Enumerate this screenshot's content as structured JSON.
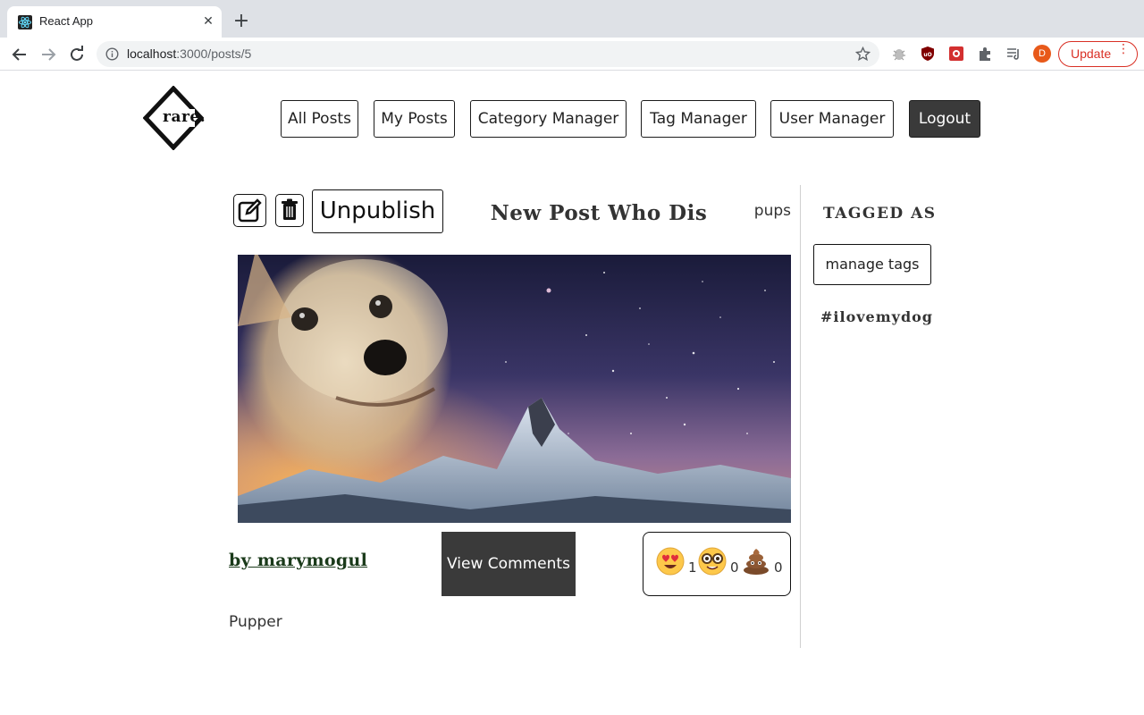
{
  "browser": {
    "tab_title": "React App",
    "tab_close": "✕",
    "new_tab": "+",
    "url_host": "localhost",
    "url_path": ":3000/posts/5",
    "profile_initial": "D",
    "update_label": "Update",
    "menu_dots": "⋮",
    "accent_color": "#d93025",
    "profile_color": "#e8591a"
  },
  "nav": {
    "logo_text": "rare.",
    "items": [
      {
        "label": "All Posts"
      },
      {
        "label": "My Posts"
      },
      {
        "label": "Category Manager"
      },
      {
        "label": "Tag Manager"
      },
      {
        "label": "User Manager"
      },
      {
        "label": "Logout"
      }
    ]
  },
  "post": {
    "title": "New Post Who Dis",
    "category": "pups",
    "unpublish_label": "Unpublish",
    "edit_icon": "edit-icon",
    "delete_icon": "trash-icon",
    "author": "by marymogul",
    "view_comments_label": "View Comments",
    "content": "Pupper",
    "reactions": [
      {
        "icon": "heart-eyes-emoji-icon",
        "count": "1"
      },
      {
        "icon": "nerd-face-emoji-icon",
        "count": "0"
      },
      {
        "icon": "poop-emoji-icon",
        "count": "0"
      }
    ]
  },
  "tags_panel": {
    "heading": "TAGGED AS",
    "manage_label": "manage tags",
    "tags": [
      "#ilovemydog"
    ]
  }
}
